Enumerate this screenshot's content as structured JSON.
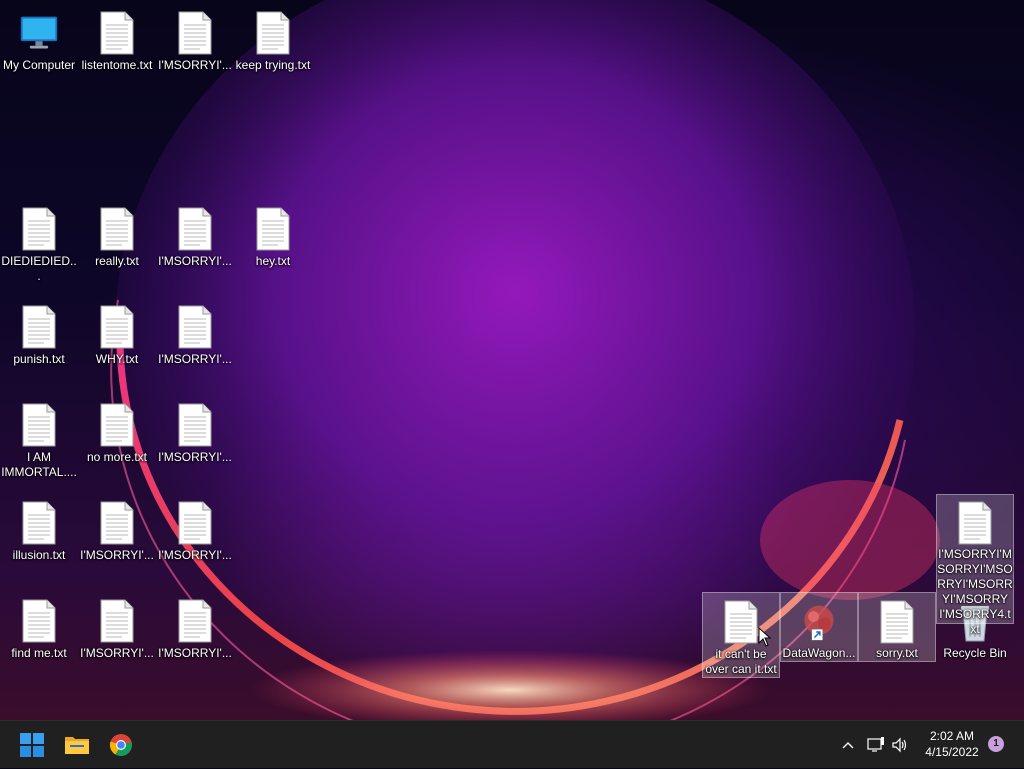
{
  "desktop": {
    "icons": [
      {
        "label": "My Computer",
        "type": "computer-icon"
      },
      {
        "label": "listentome.txt",
        "type": "text-file-icon"
      },
      {
        "label": "I'MSORRYI'...",
        "type": "text-file-icon"
      },
      {
        "label": "keep trying.txt",
        "type": "text-file-icon"
      },
      {
        "label": "DIEDIEDIED...",
        "type": "text-file-icon"
      },
      {
        "label": "really.txt",
        "type": "text-file-icon"
      },
      {
        "label": "I'MSORRYI'...",
        "type": "text-file-icon"
      },
      {
        "label": "hey.txt",
        "type": "text-file-icon"
      },
      {
        "label": "punish.txt",
        "type": "text-file-icon"
      },
      {
        "label": "WHY.txt",
        "type": "text-file-icon"
      },
      {
        "label": "I'MSORRYI'...",
        "type": "text-file-icon"
      },
      {
        "label": "I AM IMMORTAL....",
        "type": "text-file-icon"
      },
      {
        "label": "no more.txt",
        "type": "text-file-icon"
      },
      {
        "label": "I'MSORRYI'...",
        "type": "text-file-icon"
      },
      {
        "label": "illusion.txt",
        "type": "text-file-icon"
      },
      {
        "label": "I'MSORRYI'...",
        "type": "text-file-icon"
      },
      {
        "label": "I'MSORRYI'...",
        "type": "text-file-icon"
      },
      {
        "label": "find me.txt",
        "type": "text-file-icon"
      },
      {
        "label": "I'MSORRYI'...",
        "type": "text-file-icon"
      },
      {
        "label": "I'MSORRYI'...",
        "type": "text-file-icon"
      },
      {
        "label": "it can't be over can it.txt",
        "type": "text-file-icon",
        "selected": true
      },
      {
        "label": "DataWagon...",
        "type": "shortcut-icon",
        "selected": true
      },
      {
        "label": "sorry.txt",
        "type": "text-file-icon",
        "selected": true
      },
      {
        "label": "Recycle Bin",
        "type": "recycle-bin-icon"
      },
      {
        "label": "I'MSORRYI'MSORRYI'MSORRYI'MSORRYI'MSORRYI'MSORRY4.txt",
        "type": "text-file-icon",
        "selected": true
      }
    ]
  },
  "taskbar": {
    "pinned": [
      "windows-start-icon",
      "file-explorer-icon",
      "chrome-icon"
    ],
    "tray_icons": [
      "chevron-up-icon",
      "network-icon",
      "volume-icon"
    ],
    "time": "2:02 AM",
    "date": "4/15/2022",
    "notification_count": "1"
  },
  "colors": {
    "taskbar_bg": "#202020",
    "wallpaper_glow": "#b01cc8",
    "wallpaper_ring": "#ff4a6a",
    "start_blue": "#0078d4"
  }
}
